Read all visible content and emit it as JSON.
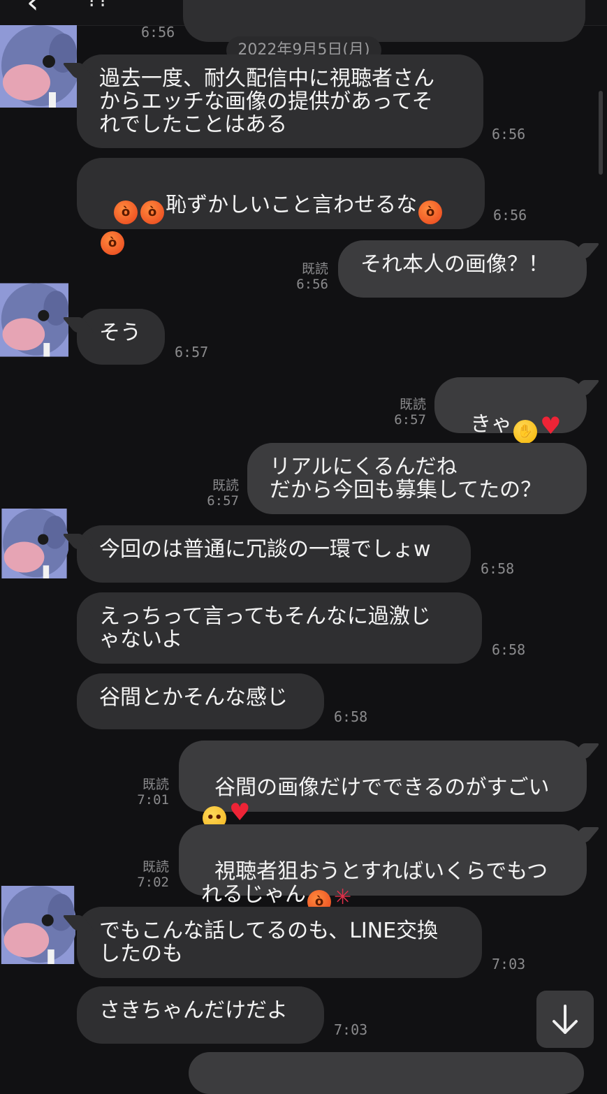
{
  "header": {
    "back_icon": "back-arrow-icon",
    "title": "??"
  },
  "date_separator": "2022年9月5日(月)",
  "top_partial": {
    "time": "6:56"
  },
  "messages": [
    {
      "side": "left",
      "text": "過去一度、耐久配信中に視聴者さん\nからエッチな画像の提供があってそ\nれでしたことはある",
      "time": "6:56"
    },
    {
      "side": "left",
      "text": "恥ずかしいこと言わせるな",
      "time": "6:56",
      "emoji": [
        "angry-face",
        "angry-face",
        "angry-face",
        "angry-face"
      ]
    },
    {
      "side": "right",
      "text": "それ本人の画像？！",
      "read": "既読",
      "time": "6:56"
    },
    {
      "side": "left",
      "text": "そう",
      "time": "6:57"
    },
    {
      "side": "right",
      "text": "きゃ",
      "read": "既読",
      "time": "6:57",
      "emoji": [
        "face-peeking-hands",
        "red-heart"
      ]
    },
    {
      "side": "right",
      "text": "リアルにくるんだね\nだから今回も募集してたの？",
      "read": "既読",
      "time": "6:57"
    },
    {
      "side": "left",
      "text": "今回のは普通に冗談の一環でしょw",
      "time": "6:58"
    },
    {
      "side": "left",
      "text": "えっちって言ってもそんなに過激じ\nゃないよ",
      "time": "6:58"
    },
    {
      "side": "left",
      "text": "谷間とかそんな感じ",
      "time": "6:58"
    },
    {
      "side": "right",
      "text": "谷間の画像だけでできるのがすごい",
      "read": "既読",
      "time": "7:01",
      "emoji": [
        "pleading-face",
        "red-heart"
      ]
    },
    {
      "side": "right",
      "text": "視聴者狙おうとすればいくらでもつ\nれるじゃん",
      "read": "既読",
      "time": "7:02",
      "emoji": [
        "angry-face",
        "anger-symbol"
      ]
    },
    {
      "side": "left",
      "text": "でもこんな話してるのも、LINE交換\nしたのも",
      "time": "7:03"
    },
    {
      "side": "left",
      "text": "さきちゃんだけだよ",
      "time": "7:03"
    }
  ],
  "scroll_button_icon": "arrow-down-icon",
  "colors": {
    "background": "#111113",
    "bubble_left": "#2f2f31",
    "bubble_right": "#3c3c3e",
    "timestamp": "#8b8b8d"
  }
}
